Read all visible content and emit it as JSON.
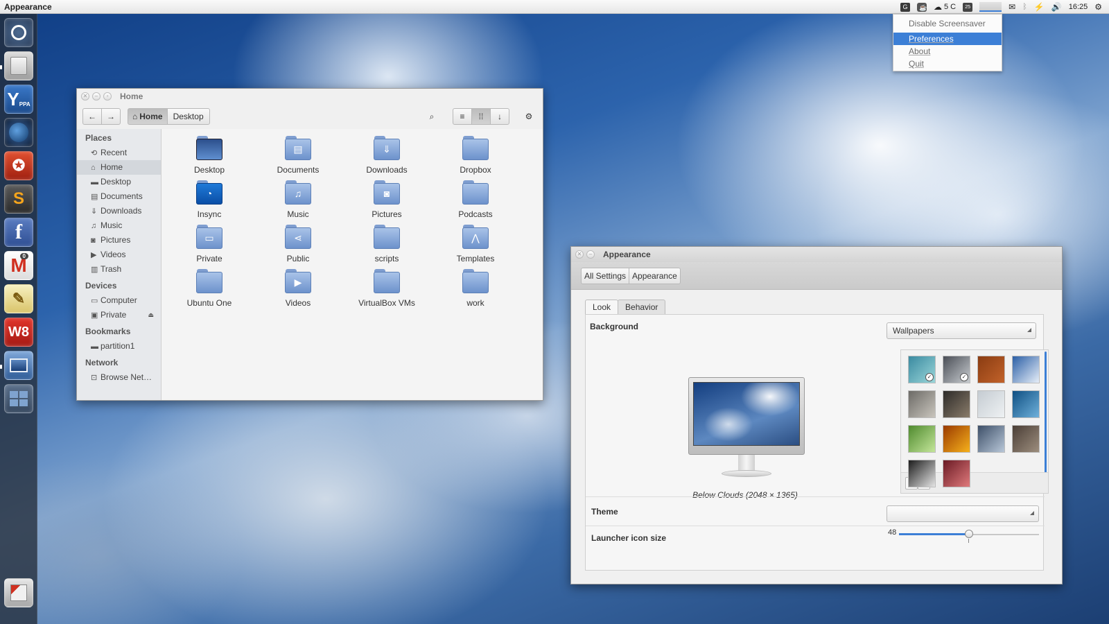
{
  "panel": {
    "app_title": "Appearance",
    "weather": "5 C",
    "calendar_day": "25",
    "time": "16:25"
  },
  "indicator_menu": {
    "items": [
      "Disable Screensaver",
      "Preferences",
      "About",
      "Quit"
    ],
    "selected": "Preferences"
  },
  "launcher": {
    "items": [
      {
        "name": "dash"
      },
      {
        "name": "files"
      },
      {
        "name": "y-ppa-manager",
        "label": "Y",
        "sub": "PPA"
      },
      {
        "name": "web-browser"
      },
      {
        "name": "software-center"
      },
      {
        "name": "sublime",
        "label": "S"
      },
      {
        "name": "facebook",
        "label": "f"
      },
      {
        "name": "gmail",
        "label": "M",
        "badge": "0"
      },
      {
        "name": "text-editor"
      },
      {
        "name": "w8",
        "label": "W8"
      },
      {
        "name": "appearance"
      },
      {
        "name": "workspaces"
      },
      {
        "name": "trash"
      }
    ]
  },
  "file_manager": {
    "title": "Home",
    "path": [
      "Home",
      "Desktop"
    ],
    "sidebar": {
      "sections": [
        {
          "heading": "Places",
          "items": [
            {
              "label": "Recent",
              "icon": "recent-icon"
            },
            {
              "label": "Home",
              "icon": "home-icon",
              "selected": true
            },
            {
              "label": "Desktop",
              "icon": "folder-icon"
            },
            {
              "label": "Documents",
              "icon": "documents-icon"
            },
            {
              "label": "Downloads",
              "icon": "download-icon"
            },
            {
              "label": "Music",
              "icon": "music-icon"
            },
            {
              "label": "Pictures",
              "icon": "camera-icon"
            },
            {
              "label": "Videos",
              "icon": "video-icon"
            },
            {
              "label": "Trash",
              "icon": "trash-icon"
            }
          ]
        },
        {
          "heading": "Devices",
          "items": [
            {
              "label": "Computer",
              "icon": "computer-icon"
            },
            {
              "label": "Private",
              "icon": "drive-icon",
              "eject": true
            }
          ]
        },
        {
          "heading": "Bookmarks",
          "items": [
            {
              "label": "partition1",
              "icon": "folder-icon"
            }
          ]
        },
        {
          "heading": "Network",
          "items": [
            {
              "label": "Browse Net…",
              "icon": "network-icon"
            }
          ]
        }
      ]
    },
    "folders": [
      {
        "label": "Desktop",
        "kind": "desktop"
      },
      {
        "label": "Documents",
        "kind": "documents"
      },
      {
        "label": "Downloads",
        "kind": "downloads"
      },
      {
        "label": "Dropbox",
        "kind": "plain"
      },
      {
        "label": "Insync",
        "kind": "insync"
      },
      {
        "label": "Music",
        "kind": "music"
      },
      {
        "label": "Pictures",
        "kind": "pictures"
      },
      {
        "label": "Podcasts",
        "kind": "plain"
      },
      {
        "label": "Private",
        "kind": "private"
      },
      {
        "label": "Public",
        "kind": "public"
      },
      {
        "label": "scripts",
        "kind": "plain"
      },
      {
        "label": "Templates",
        "kind": "templates"
      },
      {
        "label": "Ubuntu One",
        "kind": "plain"
      },
      {
        "label": "Videos",
        "kind": "videos"
      },
      {
        "label": "VirtualBox VMs",
        "kind": "plain"
      },
      {
        "label": "work",
        "kind": "plain"
      }
    ]
  },
  "appearance": {
    "title": "Appearance",
    "breadcrumb": [
      "All Settings",
      "Appearance"
    ],
    "tabs": [
      "Look",
      "Behavior"
    ],
    "active_tab": "Look",
    "background_label": "Background",
    "wallpaper_source": "Wallpapers",
    "caption": "Below Clouds (2048 × 1365)",
    "theme_label": "Theme",
    "theme_value": "",
    "launcher_size_label": "Launcher icon size",
    "launcher_size_value": "48",
    "launcher_size_fraction": 0.5,
    "add_label": "+",
    "remove_label": "−",
    "wallpapers": [
      {
        "colors": [
          "#3a8aa0",
          "#9ad6d9"
        ],
        "checked": true
      },
      {
        "colors": [
          "#4a4e56",
          "#c8ccd0"
        ],
        "checked": true
      },
      {
        "colors": [
          "#8a3c12",
          "#c2622a"
        ]
      },
      {
        "colors": [
          "#2b5fa6",
          "#e6eef8"
        ]
      },
      {
        "colors": [
          "#6c6a66",
          "#c9c5bd"
        ]
      },
      {
        "colors": [
          "#2d2b29",
          "#8a7c6a"
        ]
      },
      {
        "colors": [
          "#c5ccd2",
          "#eef1f3"
        ]
      },
      {
        "colors": [
          "#0f4f82",
          "#6fb1db"
        ]
      },
      {
        "colors": [
          "#4f8a2e",
          "#c4e69a"
        ]
      },
      {
        "colors": [
          "#9a3a00",
          "#f6b11c"
        ]
      },
      {
        "colors": [
          "#3d4f68",
          "#b8c7d8"
        ]
      },
      {
        "colors": [
          "#4a3e36",
          "#9d8e7e"
        ]
      },
      {
        "colors": [
          "#1c1c1c",
          "#e4e4e4"
        ]
      },
      {
        "colors": [
          "#6a1a24",
          "#e07a7c"
        ]
      }
    ]
  }
}
